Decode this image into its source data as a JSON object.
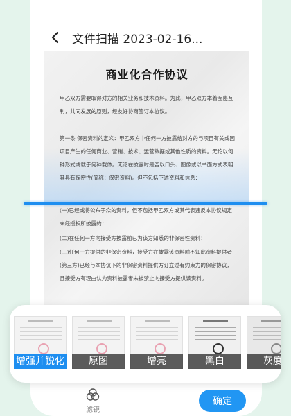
{
  "header": {
    "title": "文件扫描 2023-02-16..."
  },
  "document": {
    "title": "商业化合作协议",
    "paragraphs": [
      "甲乙双方需要取得对方的相关业务和技术资料。为此，甲乙双方本着互惠互利，共同发展的原则，经友好协商签订本协议。",
      "第一条 保密资料的定义：甲乙双方中任何一方披露给对方的与项目有关或因项目产生的任何商业、营销、技术、运营数据或其他性质的资料。无论以何种形式或载于何种载体。无论在披露时是否以口头、图像或以书面方式表明其具有保密性(简称：保密资料)。但不包括下述资料和信息：",
      "(一)已经或将公布于众的资料，但不包括甲乙双方或其代表违反本协议规定未经授权所披露的：",
      "(二)在任何一方向接受方披露前已为该方知悉的非保密性资料：",
      "(三)任何一方提供的非保密资料，接受方在披露该资料前不知此资料提供者(第三方)已经与本协议下的非保密资料提供方订立过有约束力的保密协议，且接受方有理由认为资料披露者未被禁止向接受方提供该资料。"
    ]
  },
  "filters": [
    {
      "label": "增强并锐化",
      "active": true
    },
    {
      "label": "原图",
      "active": false
    },
    {
      "label": "增亮",
      "active": false
    },
    {
      "label": "黑白",
      "active": false
    },
    {
      "label": "灰度",
      "active": false
    }
  ],
  "bottom_bar": {
    "filter_label": "滤镜",
    "confirm_label": "确定"
  },
  "colors": {
    "accent": "#2196f3",
    "background": "#e4f4ec"
  }
}
